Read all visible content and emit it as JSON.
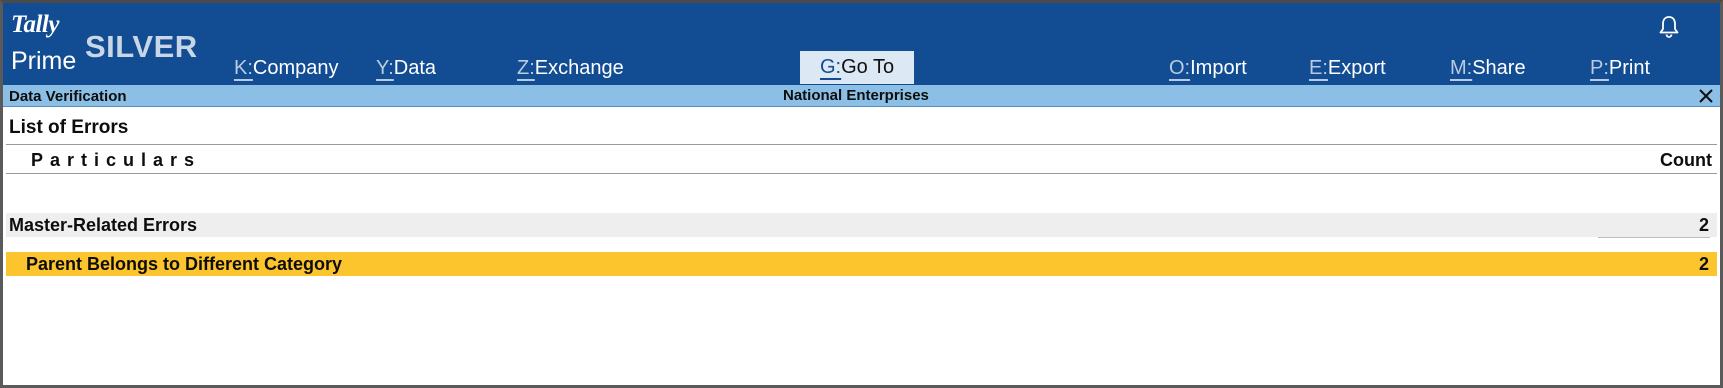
{
  "app": {
    "logo_tally": "Tally",
    "logo_prime": "Prime",
    "edition": "SILVER",
    "bell_icon": "bell-icon"
  },
  "menu": [
    {
      "key": "K:",
      "label": "Company"
    },
    {
      "key": "Y:",
      "label": "Data"
    },
    {
      "key": "Z:",
      "label": "Exchange"
    },
    {
      "key": "G:",
      "label": "Go To"
    },
    {
      "key": "O:",
      "label": "Import"
    },
    {
      "key": "E:",
      "label": "Export"
    },
    {
      "key": "M:",
      "label": "Share"
    },
    {
      "key": "P:",
      "label": "Print"
    }
  ],
  "context": {
    "screen_title": "Data Verification",
    "company": "National Enterprises",
    "close_icon": "close-icon"
  },
  "report": {
    "title": "List of Errors",
    "columns": {
      "particulars": "Particulars",
      "count": "Count"
    },
    "rows": [
      {
        "label": "Master-Related Errors",
        "count": "2",
        "type": "group"
      },
      {
        "label": "Parent Belongs to Different Category",
        "count": "2",
        "type": "item",
        "selected": true
      }
    ]
  },
  "colors": {
    "header_blue": "#124c92",
    "context_bar": "#8cbfe6",
    "selection": "#fcc42d",
    "group_row": "#eeeeee"
  }
}
